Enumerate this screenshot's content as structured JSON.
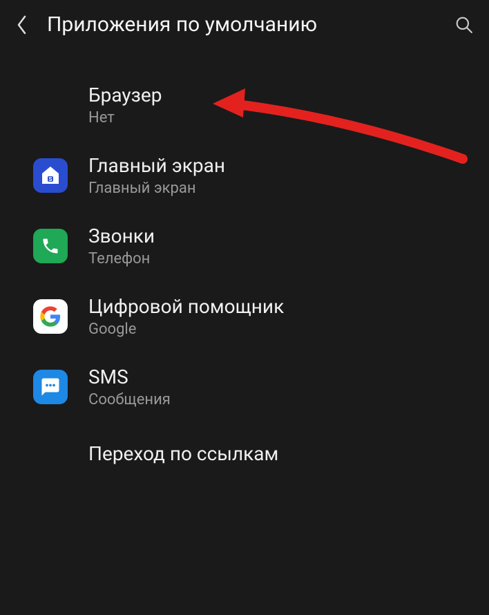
{
  "header": {
    "title": "Приложения по умолчанию"
  },
  "items": [
    {
      "title": "Браузер",
      "subtitle": "Нет",
      "icon": null
    },
    {
      "title": "Главный экран",
      "subtitle": "Главный экран",
      "icon": "home"
    },
    {
      "title": "Звонки",
      "subtitle": "Телефон",
      "icon": "phone"
    },
    {
      "title": "Цифровой помощник",
      "subtitle": "Google",
      "icon": "google"
    },
    {
      "title": "SMS",
      "subtitle": "Сообщения",
      "icon": "sms"
    },
    {
      "title": "Переход по ссылкам",
      "subtitle": "",
      "icon": null
    }
  ]
}
